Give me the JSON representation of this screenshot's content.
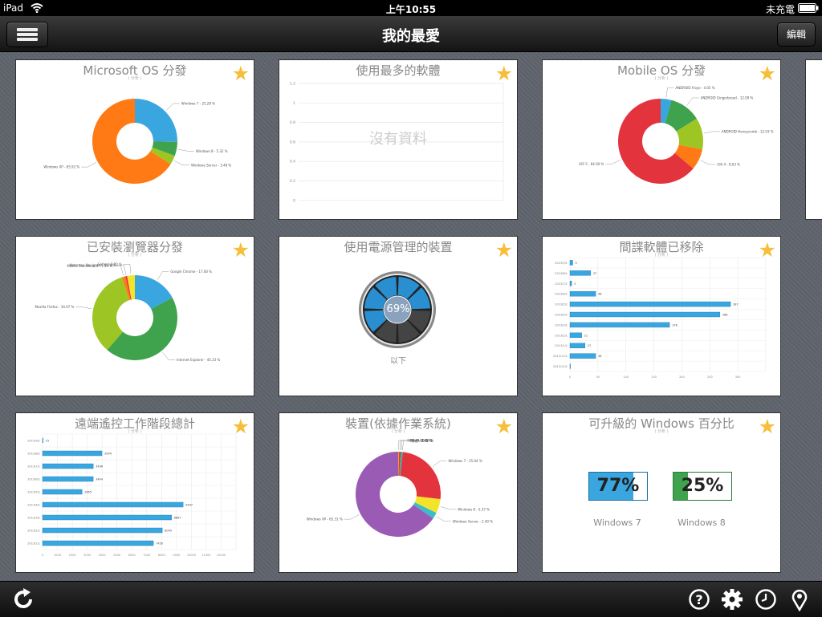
{
  "status": {
    "device": "iPad",
    "time": "上午10:55",
    "battery": "未充電"
  },
  "nav": {
    "title": "我的最愛",
    "edit": "編輯"
  },
  "toolbar": {
    "icons": [
      "refresh-icon",
      "help-icon",
      "gear-icon",
      "clock-icon",
      "location-pin-icon"
    ]
  },
  "colors": {
    "accent": "#f6be3b",
    "bar": "#3aa6e0"
  },
  "cards": {
    "ms_os": {
      "title": "Microsoft OS 分發",
      "sub": "( 分析 )",
      "chart_data": {
        "type": "pie",
        "slices": [
          {
            "name": "Windows 7 - 25.28 %",
            "value": 25.28,
            "color": "#3aa6e0"
          },
          {
            "name": "Windows 8 - 5.32 %",
            "value": 5.32,
            "color": "#3fa34d"
          },
          {
            "name": "Windows Server - 3.48 %",
            "value": 3.48,
            "color": "#9dc624"
          },
          {
            "name": "Windows XP - 65.92 %",
            "value": 65.92,
            "color": "#ff7a14"
          }
        ]
      }
    },
    "most_used": {
      "title": "使用最多的軟體",
      "sub": "",
      "no_data": "沒有資料",
      "chart_data": {
        "type": "bar",
        "yticks": [
          "1.2",
          "1",
          "0.8",
          "0.6",
          "0.4",
          "0.2",
          "0"
        ]
      }
    },
    "mobile_os": {
      "title": "Mobile OS 分發",
      "sub": "( 分析 )",
      "chart_data": {
        "type": "pie",
        "slices": [
          {
            "name": "ANDROID Froyo - 4.05 %",
            "value": 4.05,
            "color": "#3aa6e0"
          },
          {
            "name": "ANDROID Gingerbread - 12.09 %",
            "value": 12.09,
            "color": "#3fa34d"
          },
          {
            "name": "ANDROID Honeycomb - 12.03 %",
            "value": 12.03,
            "color": "#9dc624"
          },
          {
            "name": "iOS 4 - 8.03 %",
            "value": 8.03,
            "color": "#ff7a14"
          },
          {
            "name": "iOS 5 - 64.00 %",
            "value": 64.0,
            "color": "#e3343e"
          }
        ]
      }
    },
    "browser": {
      "title": "已安裝瀏覽器分發",
      "sub": "( 分析 )",
      "chart_data": {
        "type": "pie",
        "slices": [
          {
            "name": "Google Chrome - 17.60 %",
            "value": 17.6,
            "color": "#3aa6e0"
          },
          {
            "name": "Internet Explorer - 45.23 %",
            "value": 45.23,
            "color": "#3fa34d"
          },
          {
            "name": "Mozilla Firefox - 34.67 %",
            "value": 34.67,
            "color": "#9dc624"
          },
          {
            "name": "Mobile Thunderbird - 1.29 %",
            "value": 1.29,
            "color": "#ff7a14"
          },
          {
            "name": "Netscape Navigator - 0.70 %",
            "value": 0.7,
            "color": "#e3343e"
          },
          {
            "name": "Safari - 3.00 %",
            "value": 3.0,
            "color": "#f3e42b"
          }
        ]
      }
    },
    "power": {
      "title": "使用電源管理的裝置",
      "sub": "",
      "gauge_percent": "69%",
      "gauge_caption": "以下",
      "gauge_value": 0.69
    },
    "spyware": {
      "title": "間諜軟體已移除",
      "sub": "( 分析 )",
      "chart_data": {
        "type": "bar",
        "orientation": "horizontal",
        "categories": [
          "2013/9/1",
          "2013/8/1",
          "2013/7/1",
          "2013/6/1",
          "2013/5/1",
          "2013/4/1",
          "2013/3/1",
          "2013/2/1",
          "2013/1/1",
          "2012/12/1",
          "2012/11/1"
        ],
        "values": [
          5,
          37,
          3,
          46,
          287,
          268,
          178,
          21,
          27,
          46,
          0
        ],
        "xticks": [
          "0",
          "50",
          "100",
          "150",
          "200",
          "250",
          "300"
        ],
        "xlim": [
          0,
          350
        ]
      }
    },
    "remote": {
      "title": "遠端遙控工作階段總計",
      "sub": "( 分析 )",
      "chart_data": {
        "type": "bar",
        "orientation": "horizontal",
        "categories": [
          "2013/9/1",
          "2013/8/1",
          "2013/7/1",
          "2013/6/1",
          "2013/5/1",
          "2013/4/1",
          "2013/3/1",
          "2013/2/1",
          "2013/1/1"
        ],
        "values": [
          15,
          3994,
          3406,
          3404,
          2655,
          9447,
          8667,
          8045,
          7450
        ],
        "xticks": [
          "0",
          "1000",
          "2000",
          "3000",
          "4000",
          "5000",
          "6000",
          "7000",
          "8000",
          "9000",
          "10000",
          "11000",
          "12000"
        ],
        "xlim": [
          0,
          13000
        ]
      }
    },
    "device_os": {
      "title": "裝置(依據作業系統)",
      "sub": "( 分析 )",
      "chart_data": {
        "type": "pie",
        "slices": [
          {
            "name": "Android - 0.34 %",
            "value": 0.34,
            "color": "#f3a21b"
          },
          {
            "name": "iOS - 0.00 %",
            "value": 0.6,
            "color": "#e3343e"
          },
          {
            "name": "OS X - 0.42 %",
            "value": 0.42,
            "color": "#3fa34d"
          },
          {
            "name": "其他 - 0.42 %",
            "value": 0.42,
            "color": "#3aa6e0"
          },
          {
            "name": "Windows 7 - 25.04 %",
            "value": 25.04,
            "color": "#e3343e"
          },
          {
            "name": "Windows 8 - 5.37 %",
            "value": 5.37,
            "color": "#f3e42b"
          },
          {
            "name": "Windows Server - 2.40 %",
            "value": 2.4,
            "color": "#3dbcc8"
          },
          {
            "name": "Windows XP - 65.31 %",
            "value": 65.31,
            "color": "#9a5bb5"
          }
        ]
      }
    },
    "upgrade": {
      "title": "可升級的 Windows 百分比",
      "sub": "( 分析 )",
      "items": [
        {
          "label": "Windows 7",
          "percent": "77%",
          "value": 0.77,
          "color": "#3aa6e0"
        },
        {
          "label": "Windows 8",
          "percent": "25%",
          "value": 0.25,
          "color": "#3fa34d"
        }
      ]
    }
  }
}
